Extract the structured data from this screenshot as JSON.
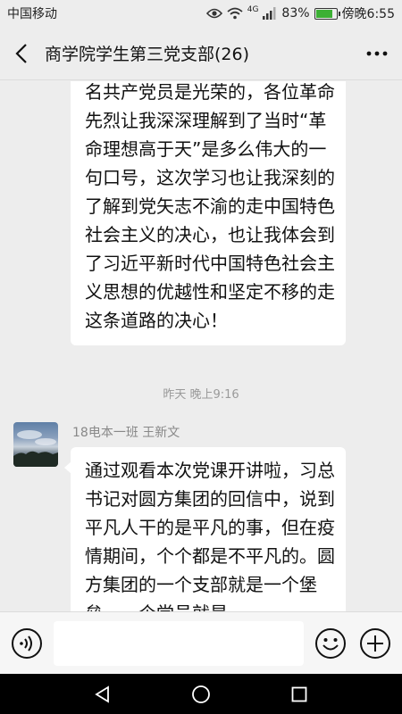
{
  "status_bar": {
    "carrier": "中国移动",
    "network_tag": "4G",
    "battery_percent": "83%",
    "battery_level": 0.83,
    "time": "傍晚6:55"
  },
  "header": {
    "title": "商学院学生第三党支部(26)"
  },
  "messages": [
    {
      "text": "名共产党员是光荣的，各位革命先烈让我深深理解到了当时“革命理想高于天”是多么伟大的一句口号，这次学习也让我深刻的了解到党矢志不渝的走中国特色社会主义的决心，也让我体会到了习近平新时代中国特色社会主义思想的优越性和坚定不移的走这条道路的决心！"
    },
    {
      "timestamp": "昨天 晚上9:16"
    },
    {
      "sender": "18电本一班 王新文",
      "text": "通过观看本次党课开讲啦，习总书记对圆方集团的回信中，说到平凡人干的是平凡的事，但在疫情期间，个个都是不平凡的。圆方集团的一个支部就是一个堡垒，一个党员就是一"
    }
  ],
  "input": {
    "value": "",
    "placeholder": ""
  },
  "icons": {
    "back": "back-arrow-icon",
    "more": "more-dots-icon",
    "voice": "voice-icon",
    "emoji": "emoji-icon",
    "plus": "plus-icon"
  },
  "colors": {
    "background": "#ededed",
    "bubble": "#ffffff",
    "battery": "#3cb034"
  }
}
